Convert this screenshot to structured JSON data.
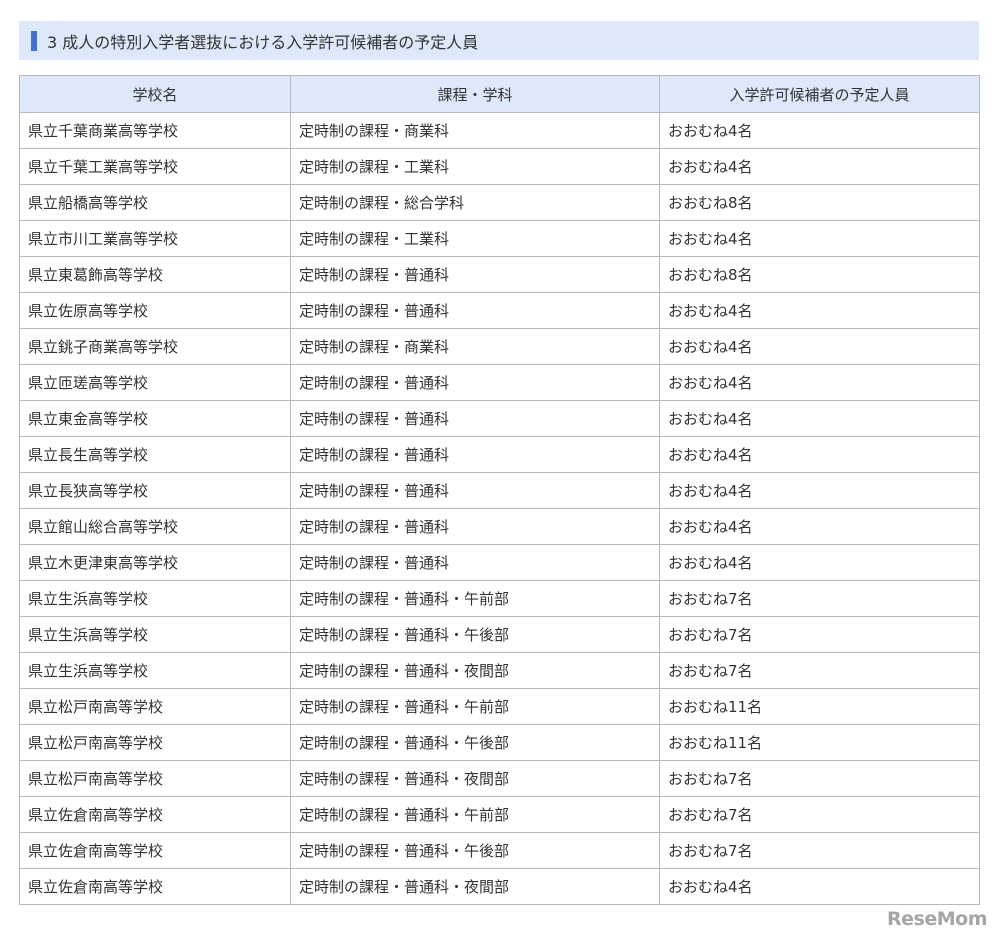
{
  "heading": {
    "title": "3 成人の特別入学者選抜における入学許可候補者の予定人員"
  },
  "table": {
    "headers": [
      "学校名",
      "課程・学科",
      "入学許可候補者の予定人員"
    ],
    "rows": [
      [
        "県立千葉商業高等学校",
        "定時制の課程・商業科",
        "おおむね4名"
      ],
      [
        "県立千葉工業高等学校",
        "定時制の課程・工業科",
        "おおむね4名"
      ],
      [
        "県立船橋高等学校",
        "定時制の課程・総合学科",
        "おおむね8名"
      ],
      [
        "県立市川工業高等学校",
        "定時制の課程・工業科",
        "おおむね4名"
      ],
      [
        "県立東葛飾高等学校",
        "定時制の課程・普通科",
        "おおむね8名"
      ],
      [
        "県立佐原高等学校",
        "定時制の課程・普通科",
        "おおむね4名"
      ],
      [
        "県立銚子商業高等学校",
        "定時制の課程・商業科",
        "おおむね4名"
      ],
      [
        "県立匝瑳高等学校",
        "定時制の課程・普通科",
        "おおむね4名"
      ],
      [
        "県立東金高等学校",
        "定時制の課程・普通科",
        "おおむね4名"
      ],
      [
        "県立長生高等学校",
        "定時制の課程・普通科",
        "おおむね4名"
      ],
      [
        "県立長狭高等学校",
        "定時制の課程・普通科",
        "おおむね4名"
      ],
      [
        "県立館山総合高等学校",
        "定時制の課程・普通科",
        "おおむね4名"
      ],
      [
        "県立木更津東高等学校",
        "定時制の課程・普通科",
        "おおむね4名"
      ],
      [
        "県立生浜高等学校",
        "定時制の課程・普通科・午前部",
        "おおむね7名"
      ],
      [
        "県立生浜高等学校",
        "定時制の課程・普通科・午後部",
        "おおむね7名"
      ],
      [
        "県立生浜高等学校",
        "定時制の課程・普通科・夜間部",
        "おおむね7名"
      ],
      [
        "県立松戸南高等学校",
        "定時制の課程・普通科・午前部",
        "おおむね11名"
      ],
      [
        "県立松戸南高等学校",
        "定時制の課程・普通科・午後部",
        "おおむね11名"
      ],
      [
        "県立松戸南高等学校",
        "定時制の課程・普通科・夜間部",
        "おおむね7名"
      ],
      [
        "県立佐倉南高等学校",
        "定時制の課程・普通科・午前部",
        "おおむね7名"
      ],
      [
        "県立佐倉南高等学校",
        "定時制の課程・普通科・午後部",
        "おおむね7名"
      ],
      [
        "県立佐倉南高等学校",
        "定時制の課程・普通科・夜間部",
        "おおむね4名"
      ]
    ]
  },
  "watermark": {
    "text": "ReseMom"
  },
  "colors": {
    "header_bg": "#dde8fb",
    "accent_bar": "#3d6fd6",
    "border": "#b9b9b9",
    "text": "#333333"
  }
}
